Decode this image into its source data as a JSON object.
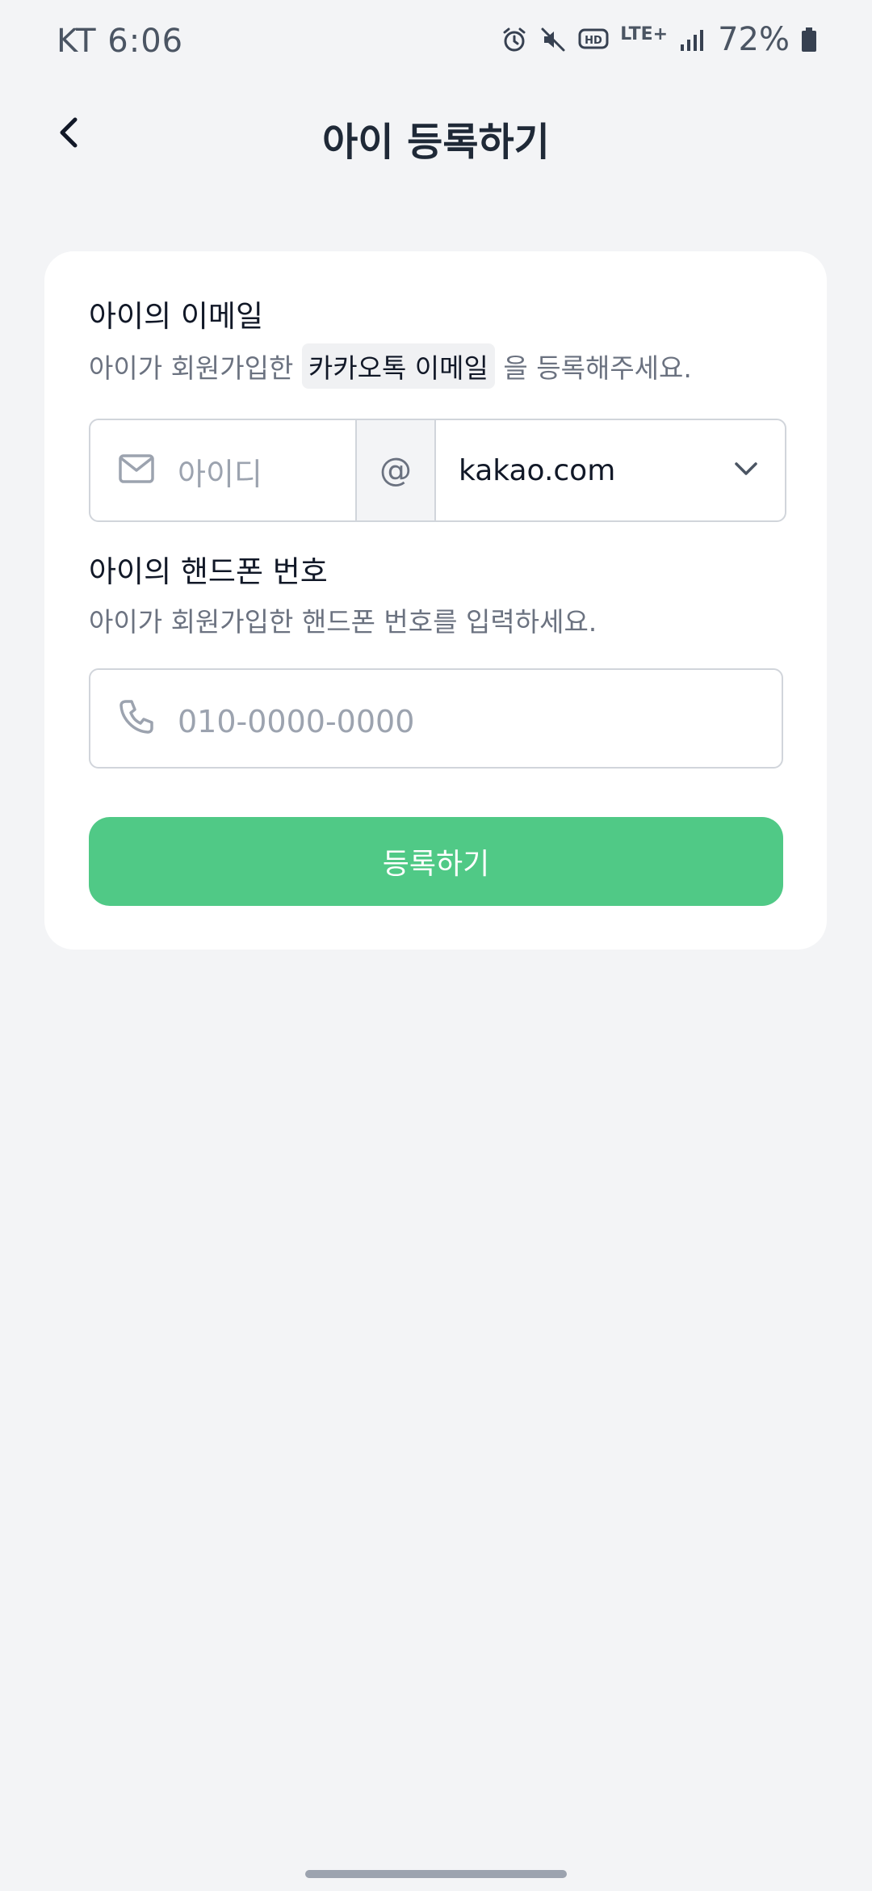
{
  "status_bar": {
    "carrier_time": "KT 6:06",
    "network": "LTE+",
    "battery": "72%",
    "icons": [
      "alarm-icon",
      "mute-icon",
      "hd-icon",
      "lte-icon",
      "signal-icon",
      "battery-icon"
    ]
  },
  "header": {
    "title": "아이 등록하기",
    "back_icon": "chevron-left-icon"
  },
  "email_section": {
    "label": "아이의 이메일",
    "desc_prefix": "아이가 회원가입한",
    "desc_highlight": "카카오톡 이메일",
    "desc_suffix": "을 등록해주세요.",
    "id_placeholder": "아이디",
    "id_value": "",
    "at": "@",
    "domain": "kakao.com",
    "mail_icon": "mail-icon",
    "dropdown_icon": "chevron-down-icon"
  },
  "phone_section": {
    "label": "아이의 핸드폰 번호",
    "desc": "아이가 회원가입한 핸드폰 번호를 입력하세요.",
    "placeholder": "010-0000-0000",
    "value": "",
    "phone_icon": "phone-icon"
  },
  "submit": {
    "label": "등록하기"
  },
  "colors": {
    "background": "#f3f4f6",
    "card": "#ffffff",
    "accent": "#50c986",
    "title": "#1f2937",
    "muted": "#6b7280",
    "border": "#d1d5db"
  }
}
